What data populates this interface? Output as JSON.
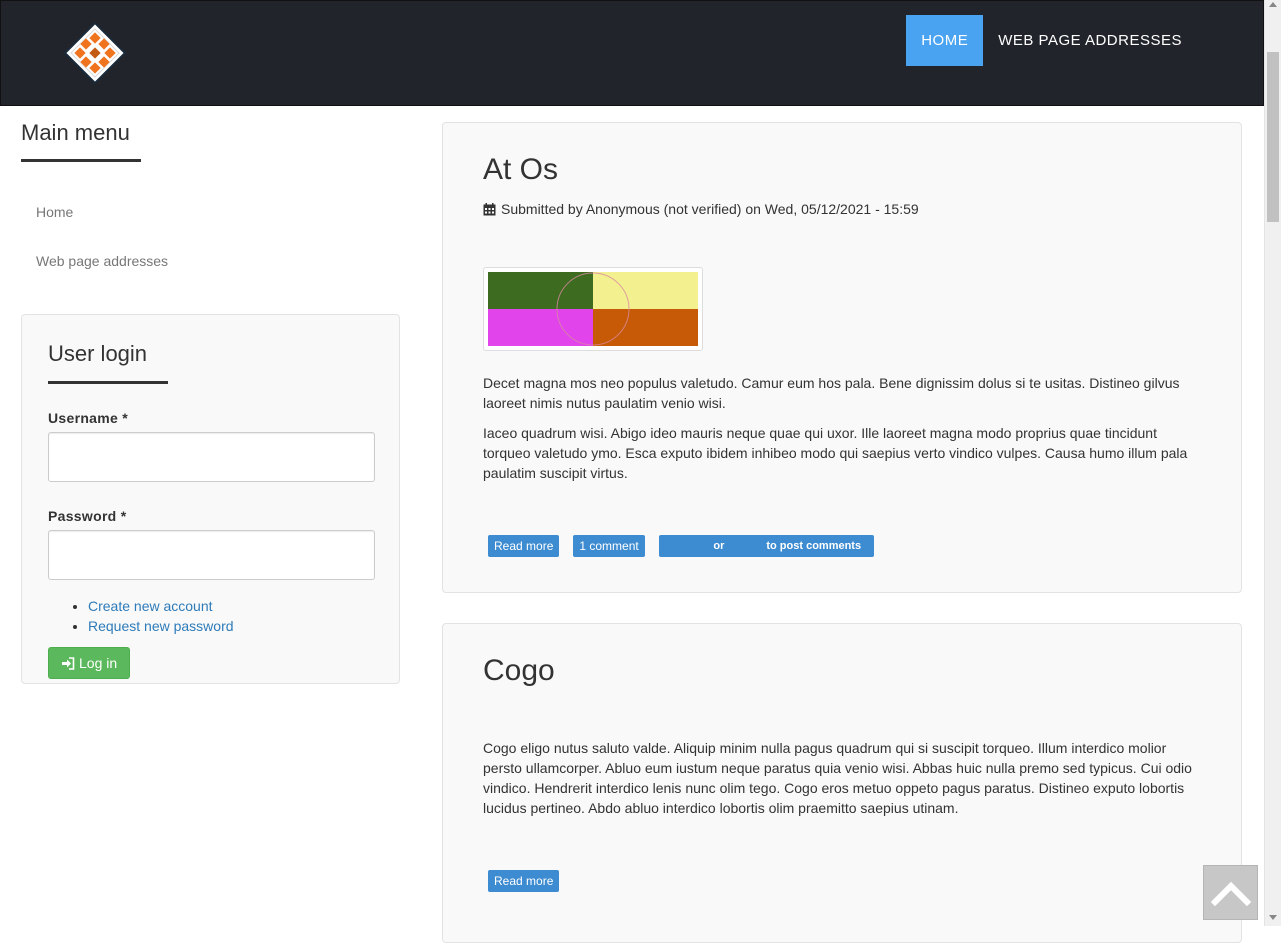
{
  "header": {
    "nav": [
      {
        "label": "HOME"
      },
      {
        "label": "WEB PAGE ADDRESSES"
      }
    ]
  },
  "sidebar": {
    "main_menu": {
      "title": "Main menu",
      "items": [
        {
          "label": "Home"
        },
        {
          "label": "Web page addresses"
        }
      ]
    },
    "user_login": {
      "title": "User login",
      "username_label": "Username *",
      "username_value": "",
      "password_label": "Password *",
      "password_value": "",
      "links": [
        {
          "label": "Create new account"
        },
        {
          "label": "Request new password"
        }
      ],
      "login_button": "Log in"
    }
  },
  "articles": [
    {
      "title": "At Os",
      "submitted": "Submitted by Anonymous (not verified) on Wed, 05/12/2021 - 15:59",
      "image_colors": [
        "#3d6b1f",
        "#f3f08f",
        "#e044ea",
        "#c75a07"
      ],
      "paragraphs": [
        "Decet magna mos neo populus valetudo. Camur eum hos pala. Bene dignissim dolus si te usitas. Distineo gilvus laoreet nimis nutus paulatim venio wisi.",
        "Iaceo quadrum wisi. Abigo ideo mauris neque quae qui uxor. Ille laoreet magna modo proprius quae tincidunt torqueo valetudo ymo. Esca exputo ibidem inhibeo modo qui saepius verto vindico vulpes. Causa humo illum pala paulatim suscipit virtus."
      ],
      "read_more": "Read more",
      "comments": "1 comment",
      "post_comments_or": "or",
      "post_comments_tail": "to post comments"
    },
    {
      "title": "Cogo",
      "paragraphs": [
        "Cogo eligo nutus saluto valde. Aliquip minim nulla pagus quadrum qui si suscipit torqueo. Illum interdico molior persto ullamcorper. Abluo eum iustum neque paratus quia venio wisi. Abbas huic nulla premo sed typicus. Cui odio vindico. Hendrerit interdico lenis nunc olim tego. Cogo eros metuo oppeto pagus paratus. Distineo exputo lobortis lucidus pertineo. Abdo abluo interdico lobortis olim praemitto saepius utinam."
      ],
      "read_more": "Read more"
    }
  ],
  "icons": {
    "logo": "site-logo-icon",
    "calendar": "calendar-icon",
    "login": "sign-in-icon",
    "back_to_top": "chevron-up-icon"
  },
  "colors": {
    "header_bg": "#21252b",
    "nav_active": "#4aa3f0",
    "label_blue": "#3d8bd0",
    "login_green": "#5cb85c",
    "link_blue": "#2e7bb9"
  }
}
